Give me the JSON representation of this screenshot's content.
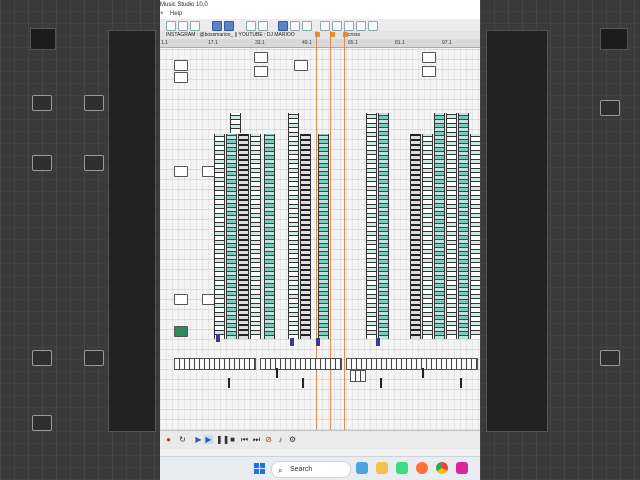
{
  "window": {
    "title": "Music Studio 10.0",
    "menu_close": "×",
    "menu_help": "Help"
  },
  "marker_strip": {
    "text": "INSTAGRAM : @bossmarioo_ || YOUTUBE : DJ MARIOO",
    "flag_label": "cross"
  },
  "ruler": {
    "labels": [
      "1.1",
      "17.1",
      "33.1",
      "49.1",
      "65.1",
      "81.1",
      "97.1"
    ]
  },
  "transport": {
    "buttons": [
      "record",
      "loop",
      "play",
      "play-selection",
      "pause",
      "stop",
      "previous",
      "next",
      "record-stop",
      "metronome",
      "settings"
    ]
  },
  "taskbar": {
    "search_label": "Search",
    "apps": [
      "windows-start",
      "search",
      "cloud-app",
      "file-manager",
      "android-app",
      "firefox-browser",
      "chrome-browser",
      "instagram-app"
    ]
  },
  "colors": {
    "accent_blue": "#5a82c8",
    "cue_orange": "#e07a3a",
    "note_teal": "#7ccabc",
    "note_purple": "#3b3b8f"
  }
}
